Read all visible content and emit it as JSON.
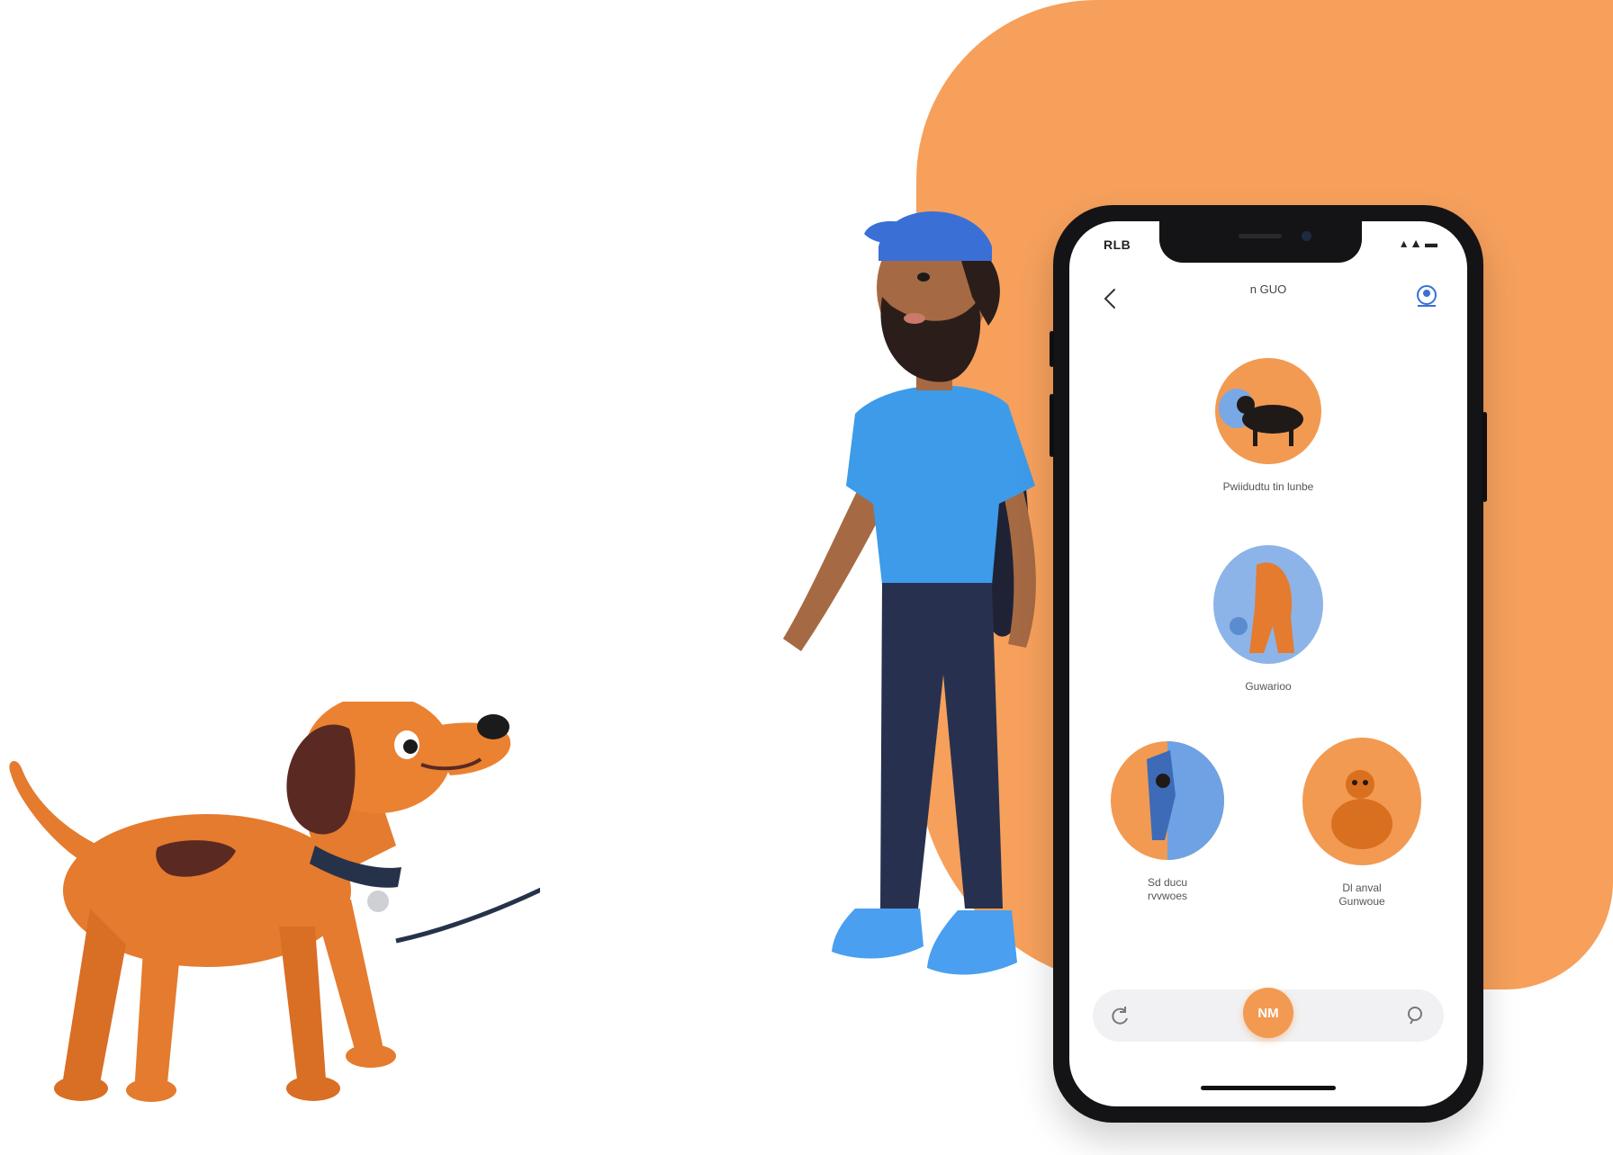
{
  "colors": {
    "accent": "#f29a52",
    "blob": "#f6a05c",
    "phone_frame": "#141416",
    "shirt": "#3d9be9",
    "dog": "#e0782f"
  },
  "status_bar": {
    "time": "RLB",
    "icons": "▴▲▬"
  },
  "nav": {
    "back_icon": "chevron-left-icon",
    "title": "n GUO",
    "profile_icon": "user-circle-icon"
  },
  "walks": [
    {
      "caption": "Pwiidudtu tin lunbe",
      "icon": "dog-icon"
    },
    {
      "caption": "Guwarioo",
      "icon": "dog-icon"
    },
    {
      "caption": "Sd ducu\nrvvwoes",
      "icon": "dog-icon"
    },
    {
      "caption": "Dl anval\nGunwoue",
      "icon": "dog-icon"
    }
  ],
  "bottom_bar": {
    "left_icon": "refresh-icon",
    "center_label": "NM",
    "right_icon": "search-icon"
  }
}
